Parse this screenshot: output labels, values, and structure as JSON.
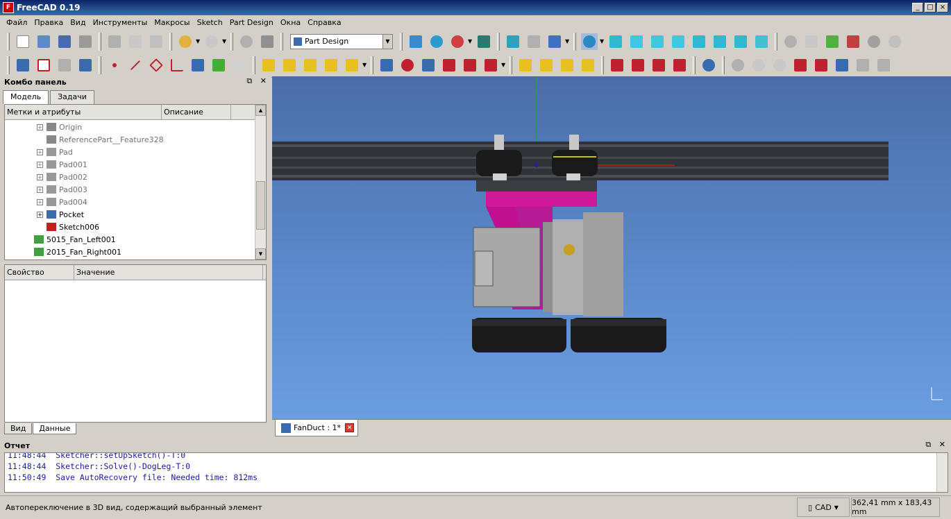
{
  "window": {
    "title": "FreeCAD 0.19",
    "app_icon": "freecad-icon",
    "btn_min": "_",
    "btn_max": "□",
    "btn_close": "×"
  },
  "menu": [
    "Файл",
    "Правка",
    "Вид",
    "Инструменты",
    "Макросы",
    "Sketch",
    "Part Design",
    "Окна",
    "Справка"
  ],
  "workbench": {
    "selected": "Part Design"
  },
  "combo": {
    "title": "Комбо панель",
    "float_icon": "⧉",
    "close_icon": "✕",
    "tabs": [
      "Модель",
      "Задачи"
    ],
    "tree_columns": [
      "Метки и атрибуты",
      "Описание"
    ],
    "tree_items": [
      {
        "label": "Origin",
        "icon": "origin-icon",
        "indent": 1,
        "expander": "+",
        "gray": true
      },
      {
        "label": "ReferencePart__Feature328",
        "icon": "part-feature-icon",
        "indent": 1,
        "expander": "",
        "gray": true
      },
      {
        "label": "Pad",
        "icon": "pad-icon",
        "indent": 1,
        "expander": "+",
        "gray": true
      },
      {
        "label": "Pad001",
        "icon": "pad-icon",
        "indent": 1,
        "expander": "+",
        "gray": true
      },
      {
        "label": "Pad002",
        "icon": "pad-icon",
        "indent": 1,
        "expander": "+",
        "gray": true
      },
      {
        "label": "Pad003",
        "icon": "pad-icon",
        "indent": 1,
        "expander": "+",
        "gray": true
      },
      {
        "label": "Pad004",
        "icon": "pad-icon",
        "indent": 1,
        "expander": "+",
        "gray": true
      },
      {
        "label": "Pocket",
        "icon": "pocket-icon",
        "indent": 1,
        "expander": "+",
        "gray": false
      },
      {
        "label": "Sketch006",
        "icon": "sketch-icon",
        "indent": 1,
        "expander": "",
        "gray": false
      },
      {
        "label": "5015_Fan_Left001",
        "icon": "mesh-icon",
        "indent": 0,
        "expander": "",
        "gray": false
      },
      {
        "label": "2015_Fan_Right001",
        "icon": "mesh-icon",
        "indent": 0,
        "expander": "",
        "gray": false
      }
    ],
    "prop_columns": [
      "Свойство",
      "Значение"
    ],
    "bottom_tabs": [
      "Вид",
      "Данные"
    ]
  },
  "doc_tab": {
    "label": "FanDuct : 1*",
    "close": "✕"
  },
  "report": {
    "title": "Отчет",
    "lines": [
      "11:48:44  Sketcher::setUpSketch()-T:0",
      "11:48:44  Sketcher::Solve()-DogLeg-T:0",
      "11:50:49  Save AutoRecovery file: Needed time: 812ms"
    ]
  },
  "status": {
    "message": "Автопереключение в 3D вид, содержащий выбранный элемент",
    "nav_style": "CAD",
    "dimensions": "362,41 mm x 183,43 mm"
  },
  "colors": {
    "accent_pink": "#d0189a",
    "view_top": "#4a6ea8",
    "view_bottom": "#6a9ee0"
  }
}
